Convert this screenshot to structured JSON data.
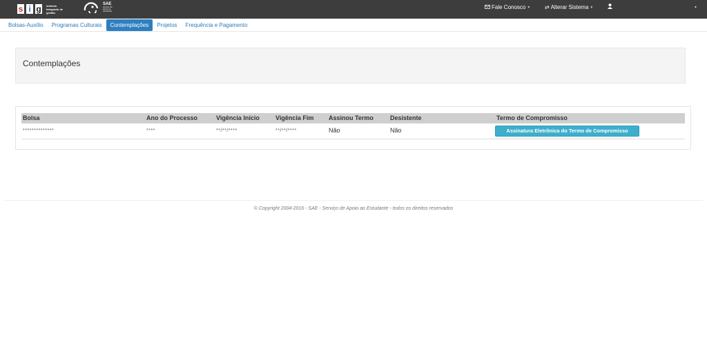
{
  "brand": {
    "sig_letters": [
      "s",
      "i",
      "g"
    ],
    "sig_subtitle": "sistema integrado de gestão",
    "sae_label": "SAE",
    "sae_subtitle": "serviço de apoio ao estudante"
  },
  "topnav": {
    "contact_label": "Fale Conosco",
    "contact_icon": "envelope-icon",
    "switch_label": "Alterar Sistema",
    "switch_icon": "exchange-arrows-icon",
    "user_icon": "user-icon"
  },
  "tabs": [
    {
      "label": "Bolsas-Auxílio",
      "active": false
    },
    {
      "label": "Programas Culturais",
      "active": false
    },
    {
      "label": "Contemplações",
      "active": true
    },
    {
      "label": "Projetos",
      "active": false
    },
    {
      "label": "Frequência e Pagamento",
      "active": false
    }
  ],
  "page": {
    "title": "Contemplações"
  },
  "table": {
    "headers": [
      "Bolsa",
      "Ano do Processo",
      "Vigência Início",
      "Vigência Fim",
      "Assinou Termo",
      "Desistente",
      "Termo de Compromisso"
    ],
    "rows": [
      {
        "bolsa": "**************",
        "ano": "****",
        "inicio": "**/**/****",
        "fim": "**/**/****",
        "assinou": "Não",
        "desistente": "Não",
        "action_label": "Assinatura Eletrônica do Termo de Compromisso"
      }
    ]
  },
  "footer": {
    "copyright": "© Copyright 2004-2016 - SAE - Serviço de Apoio ao Estudante - todos os direitos reservados"
  },
  "colors": {
    "topbar": "#3d3d3d",
    "active_tab": "#2e7fc1",
    "link": "#2a7ab8",
    "action_button": "#3eaecd"
  }
}
